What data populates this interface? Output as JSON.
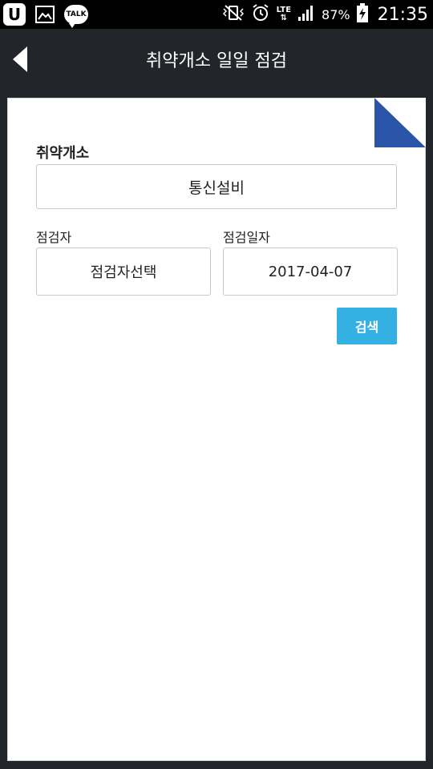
{
  "status_bar": {
    "left_icons": [
      "u-plus-icon",
      "gallery-icon",
      "kakao-talk-icon"
    ],
    "talk_label": "TALK",
    "u_label": "U",
    "network": "LTE",
    "battery_percent": "87%",
    "time": "21:35"
  },
  "header": {
    "title": "취약개소 일일 점검"
  },
  "form": {
    "vulnerable_label": "취약개소",
    "vulnerable_value": "통신설비",
    "inspector_label": "점검자",
    "inspector_value": "점검자선택",
    "date_label": "점검일자",
    "date_value": "2017-04-07",
    "search_button": "검색"
  },
  "colors": {
    "header_bg": "#22262a",
    "accent_button": "#35b0e2",
    "corner_fold": "#2a54a8"
  }
}
